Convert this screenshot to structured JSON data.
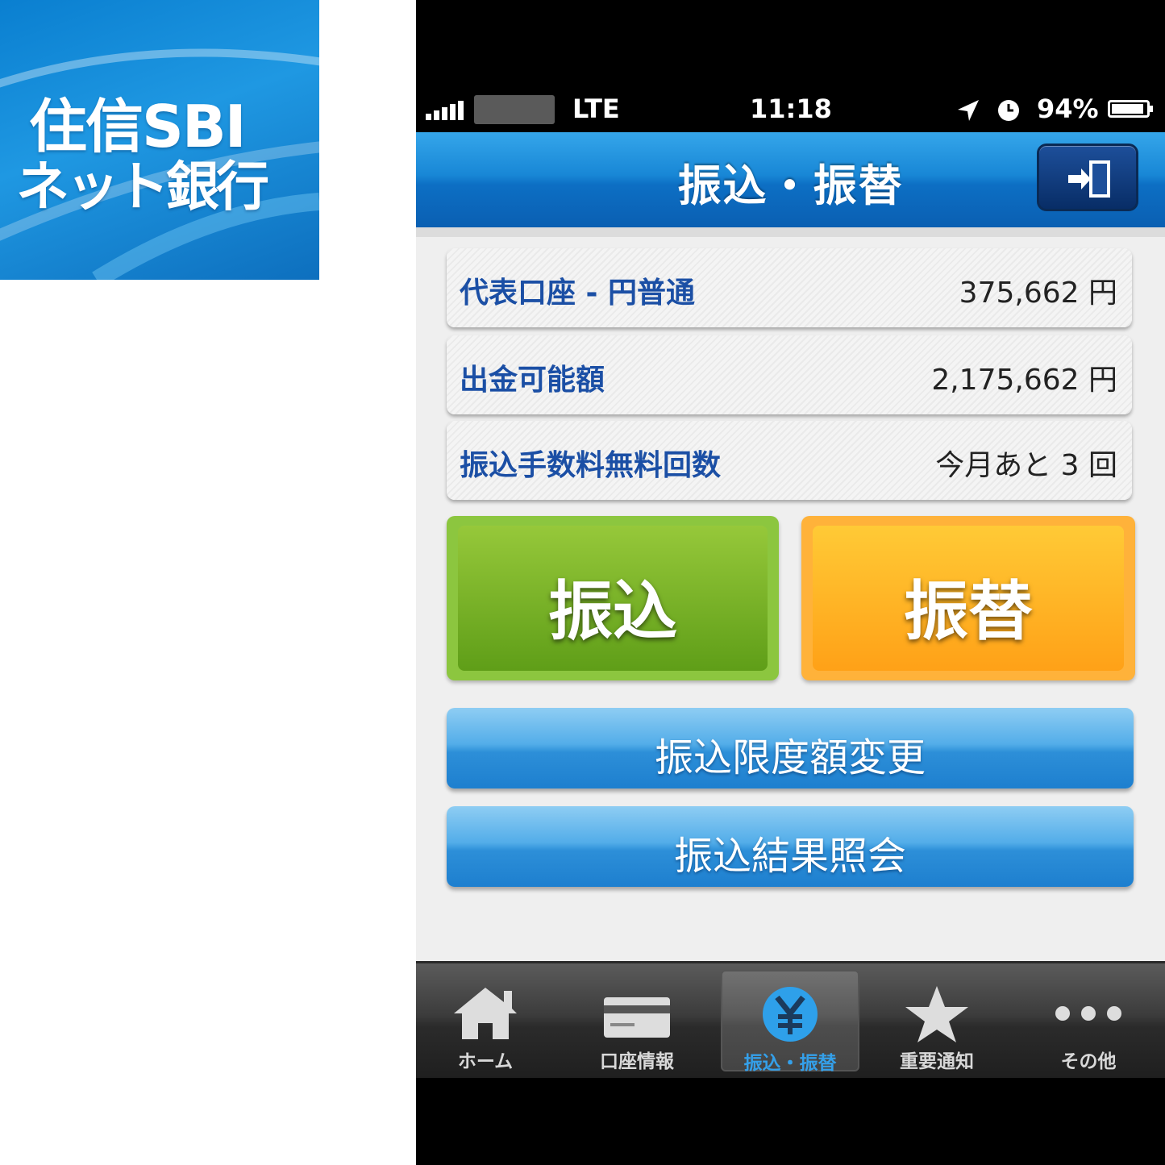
{
  "logo": {
    "line1": "住信SBI",
    "line2": "ネット銀行"
  },
  "status_bar": {
    "network": "LTE",
    "time": "11:18",
    "battery": "94%",
    "battery_level": 0.94
  },
  "nav": {
    "title": "振込・振替",
    "logout_icon": "logout-icon"
  },
  "info_rows": [
    {
      "label": "代表口座 - 円普通",
      "value": "375,662 円"
    },
    {
      "label": "出金可能額",
      "value": "2,175,662 円"
    },
    {
      "label": "振込手数料無料回数",
      "value": "今月あと 3 回"
    }
  ],
  "actions": {
    "transfer": "振込",
    "exchange": "振替"
  },
  "menu": {
    "limit_change": "振込限度額変更",
    "result_inquiry": "振込結果照会"
  },
  "tabs": [
    {
      "label": "ホーム",
      "icon": "home-icon"
    },
    {
      "label": "口座情報",
      "icon": "card-icon"
    },
    {
      "label": "振込・振替",
      "icon": "yen-icon",
      "active": true
    },
    {
      "label": "重要通知",
      "icon": "star-icon"
    },
    {
      "label": "その他",
      "icon": "more-dots-icon"
    }
  ],
  "colors": {
    "accent_blue": "#1887d6",
    "transfer_green": "#6fae25",
    "exchange_orange": "#ffa117",
    "active_tab": "#34a0ea"
  }
}
